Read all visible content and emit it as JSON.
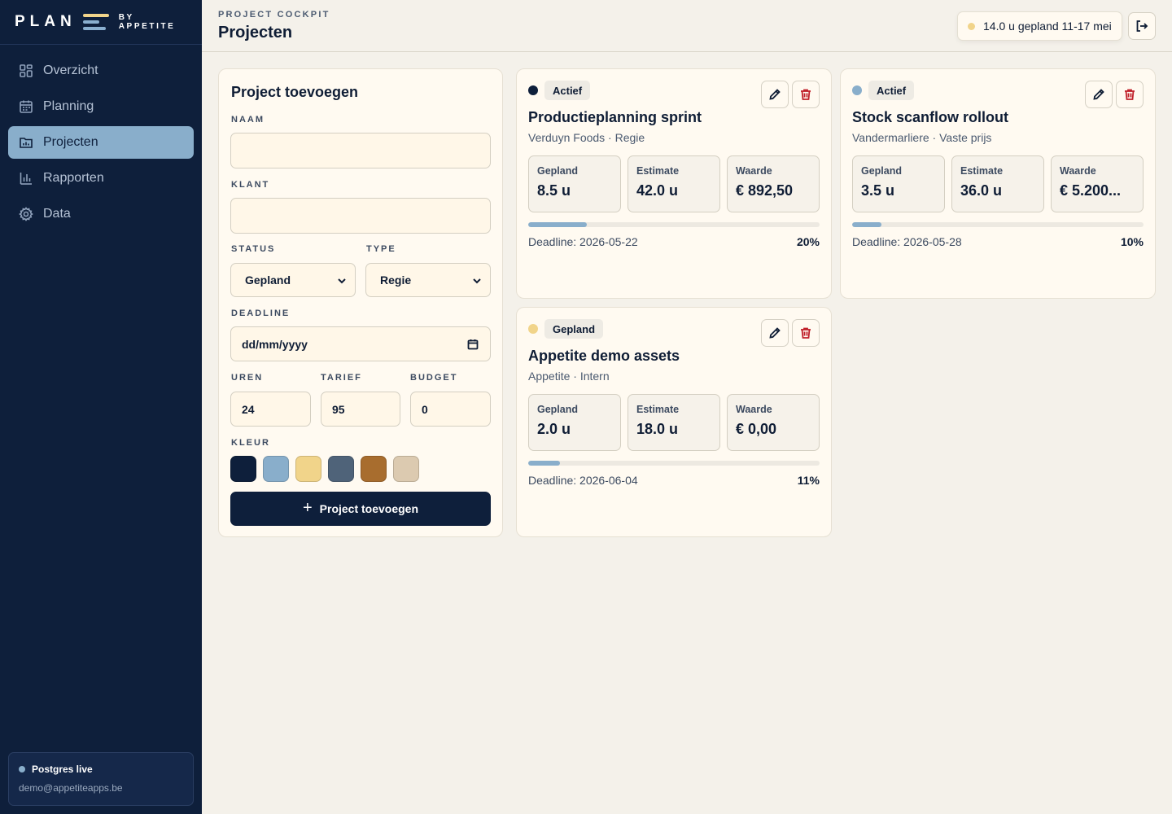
{
  "brand": {
    "name": "PLAN",
    "by_line1": "BY",
    "by_line2": "APPETITE"
  },
  "nav": [
    {
      "label": "Overzicht",
      "icon": "grid-icon"
    },
    {
      "label": "Planning",
      "icon": "calendar-icon"
    },
    {
      "label": "Projecten",
      "icon": "folder-chart-icon",
      "active": true
    },
    {
      "label": "Rapporten",
      "icon": "bar-chart-icon"
    },
    {
      "label": "Data",
      "icon": "gear-icon"
    }
  ],
  "footer": {
    "status": "Postgres live",
    "email": "demo@appetiteapps.be"
  },
  "header": {
    "eyebrow": "PROJECT COCKPIT",
    "title": "Projecten",
    "week_summary": "14.0 u gepland 11-17 mei"
  },
  "form": {
    "title": "Project toevoegen",
    "naam_label": "NAAM",
    "naam_value": "",
    "klant_label": "KLANT",
    "klant_value": "",
    "status_label": "STATUS",
    "status_value": "Gepland",
    "type_label": "TYPE",
    "type_value": "Regie",
    "deadline_label": "DEADLINE",
    "deadline_placeholder": "dd/mm/yyyy",
    "uren_label": "UREN",
    "uren_value": "24",
    "tarief_label": "TARIEF",
    "tarief_value": "95",
    "budget_label": "BUDGET",
    "budget_value": "0",
    "kleur_label": "KLEUR",
    "colors": [
      "#0e1f3b",
      "#89aecb",
      "#f1d48a",
      "#4f6379",
      "#a86d2e",
      "#dccab0"
    ],
    "submit_label": "Project toevoegen"
  },
  "projects": [
    {
      "status": "Actief",
      "dot_color": "#0e1f3b",
      "title": "Productieplanning sprint",
      "subtitle": "Verduyn Foods · Regie",
      "gepland_label": "Gepland",
      "gepland": "8.5 u",
      "estimate_label": "Estimate",
      "estimate": "42.0 u",
      "waarde_label": "Waarde",
      "waarde": "€ 892,50",
      "deadline": "Deadline: 2026-05-22",
      "percent_label": "20%",
      "progress": 0.2
    },
    {
      "status": "Actief",
      "dot_color": "#89aecb",
      "title": "Stock scanflow rollout",
      "subtitle": "Vandermarliere · Vaste prijs",
      "gepland_label": "Gepland",
      "gepland": "3.5 u",
      "estimate_label": "Estimate",
      "estimate": "36.0 u",
      "waarde_label": "Waarde",
      "waarde": "€ 5.200...",
      "deadline": "Deadline: 2026-05-28",
      "percent_label": "10%",
      "progress": 0.1
    },
    {
      "status": "Gepland",
      "dot_color": "#f1d48a",
      "title": "Appetite demo assets",
      "subtitle": "Appetite · Intern",
      "gepland_label": "Gepland",
      "gepland": "2.0 u",
      "estimate_label": "Estimate",
      "estimate": "18.0 u",
      "waarde_label": "Waarde",
      "waarde": "€ 0,00",
      "deadline": "Deadline: 2026-06-04",
      "percent_label": "11%",
      "progress": 0.11
    }
  ]
}
